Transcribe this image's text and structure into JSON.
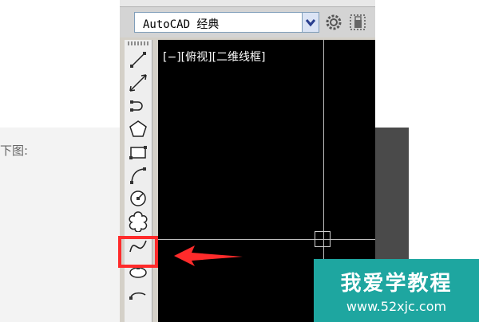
{
  "article": {
    "fragment_text": "下图:"
  },
  "workspace": {
    "selected": "AutoCAD 经典"
  },
  "toolbar": {
    "icons": [
      "line-icon",
      "construction-line-icon",
      "polyline-icon",
      "polygon-icon",
      "rectangle-icon",
      "arc-icon",
      "circle-icon",
      "revision-cloud-icon",
      "spline-icon",
      "ellipse-icon",
      "ellipse-arc-icon"
    ]
  },
  "viewport": {
    "label": "[−][俯视][二维线框]"
  },
  "colors": {
    "highlight": "#ff2b2b",
    "watermark_bg": "#1ea6a0",
    "viewport_bg": "#000000"
  },
  "watermark": {
    "title": "我爱学教程",
    "url": "www.52xjc.com"
  }
}
